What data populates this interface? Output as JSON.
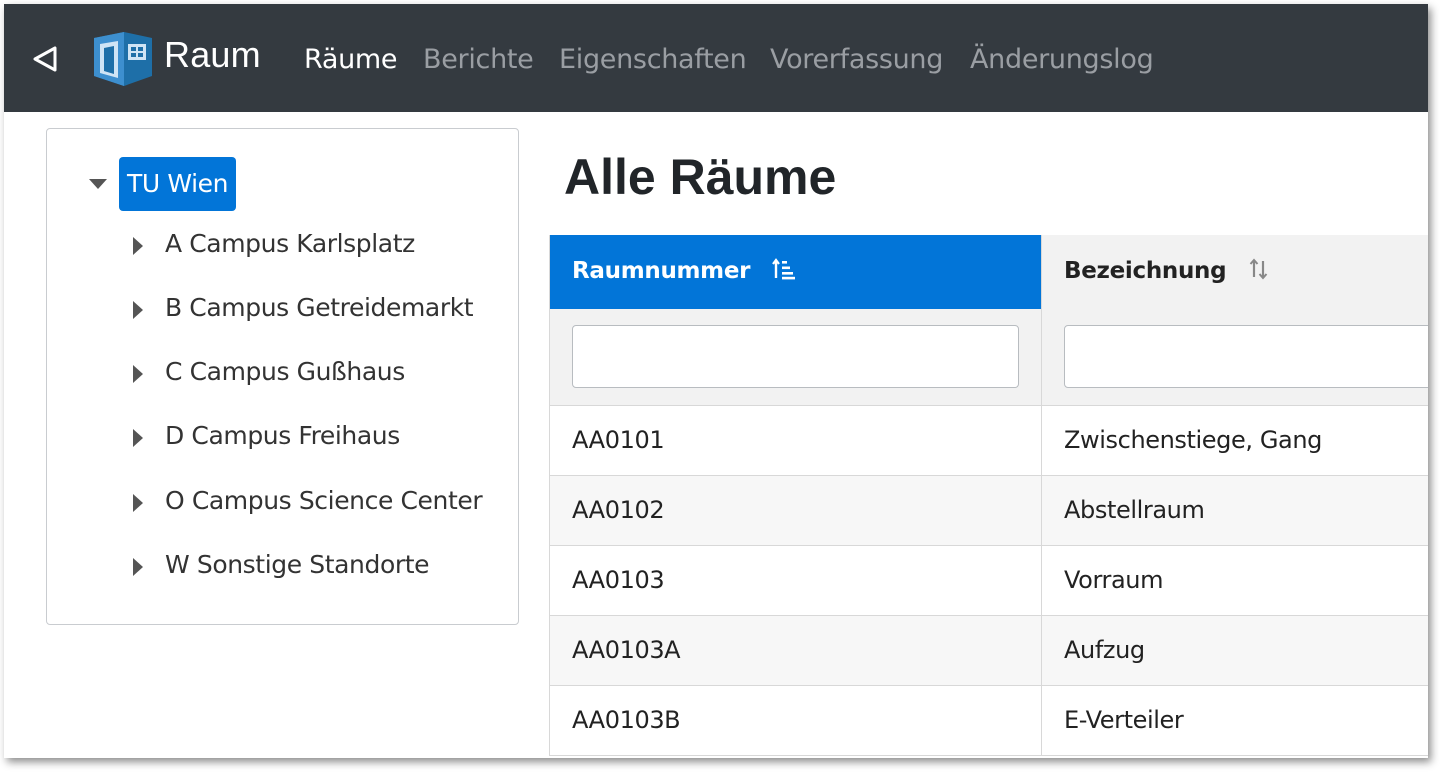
{
  "navbar": {
    "back_icon": "back-triangle-icon",
    "logo_icon": "room-door-logo-icon",
    "brand": "Raum",
    "links": [
      {
        "label": "Räume",
        "active": true
      },
      {
        "label": "Berichte",
        "active": false
      },
      {
        "label": "Eigenschaften",
        "active": false
      },
      {
        "label": "Vorerfassung",
        "active": false
      },
      {
        "label": "Änderungslog",
        "active": false
      }
    ],
    "colors": {
      "background": "#343a40",
      "active": "#ffffff",
      "inactive": "#9a9ea3"
    }
  },
  "tree": {
    "root": {
      "label": "TU Wien",
      "expanded": true
    },
    "children": [
      {
        "label": "A Campus Karlsplatz"
      },
      {
        "label": "B Campus Getreidemarkt"
      },
      {
        "label": "C Campus Gußhaus"
      },
      {
        "label": "D Campus Freihaus"
      },
      {
        "label": "O Campus Science Center"
      },
      {
        "label": "W Sonstige Standorte"
      }
    ],
    "accent": "#0275d8"
  },
  "main": {
    "title": "Alle Räume",
    "table": {
      "columns": [
        {
          "label": "Raumnummer",
          "sort_icon": "sort-ascending-icon",
          "sorted": true
        },
        {
          "label": "Bezeichnung",
          "sort_icon": "sort-both-icon",
          "sorted": false
        }
      ],
      "filters": [
        {
          "value": "",
          "placeholder": ""
        },
        {
          "value": "",
          "placeholder": ""
        }
      ],
      "rows": [
        [
          "AA0101",
          "Zwischenstiege, Gang"
        ],
        [
          "AA0102",
          "Abstellraum"
        ],
        [
          "AA0103",
          "Vorraum"
        ],
        [
          "AA0103A",
          "Aufzug"
        ],
        [
          "AA0103B",
          "E-Verteiler"
        ]
      ]
    }
  }
}
